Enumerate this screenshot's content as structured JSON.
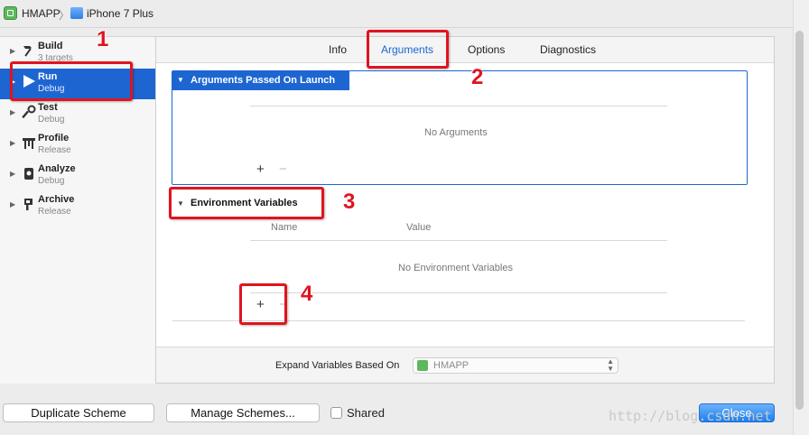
{
  "breadcrumb": {
    "scheme": "HMAPP",
    "separator": "〉",
    "device": "iPhone 7 Plus"
  },
  "sidebar": {
    "items": [
      {
        "label": "Build",
        "sub": "3 targets",
        "icon": "hammer-icon"
      },
      {
        "label": "Run",
        "sub": "Debug",
        "icon": "play-icon"
      },
      {
        "label": "Test",
        "sub": "Debug",
        "icon": "wrench-icon"
      },
      {
        "label": "Profile",
        "sub": "Release",
        "icon": "instruments-icon"
      },
      {
        "label": "Analyze",
        "sub": "Debug",
        "icon": "analyze-icon"
      },
      {
        "label": "Archive",
        "sub": "Release",
        "icon": "archive-icon"
      }
    ],
    "selected": "Run"
  },
  "tabs": [
    {
      "label": "Info"
    },
    {
      "label": "Arguments"
    },
    {
      "label": "Options"
    },
    {
      "label": "Diagnostics"
    }
  ],
  "active_tab": "Arguments",
  "arguments_section": {
    "header": "Arguments Passed On Launch",
    "empty_text": "No Arguments",
    "add_symbol": "+",
    "remove_symbol": "−"
  },
  "env_section": {
    "header": "Environment Variables",
    "col_name": "Name",
    "col_value": "Value",
    "empty_text": "No Environment Variables",
    "add_symbol": "+",
    "remove_symbol": "−"
  },
  "expand": {
    "label": "Expand Variables Based On",
    "value": "HMAPP"
  },
  "buttons": {
    "duplicate": "Duplicate Scheme",
    "manage": "Manage Schemes...",
    "shared": "Shared",
    "close": "Close"
  },
  "annotations": [
    "1",
    "2",
    "3",
    "4"
  ],
  "watermark": "http://blog.csdn.net",
  "colors": {
    "accent": "#1d66d2",
    "annotation": "#e0141e"
  }
}
